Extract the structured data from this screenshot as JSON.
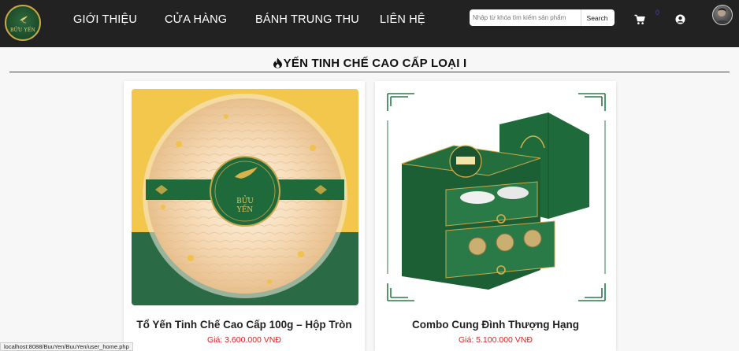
{
  "brand": {
    "logo_text": "BỬU YẾN"
  },
  "nav": {
    "items": [
      {
        "label": "GIỚI THIỆU"
      },
      {
        "label": "CỬA HÀNG"
      },
      {
        "label": "BÁNH TRUNG THU"
      },
      {
        "label": "LIÊN HỆ"
      }
    ]
  },
  "search": {
    "placeholder": "Nhập từ khóa tìm kiếm sản phẩm",
    "value": "",
    "button_label": "Search"
  },
  "cart": {
    "count": "0"
  },
  "section": {
    "title": "YẾN TINH CHẾ CAO CẤP LOẠI I"
  },
  "products": [
    {
      "name": "Tổ Yến Tinh Chế Cao Cấp 100g – Hộp Tròn",
      "price": "Giá: 3.600.000 VNĐ",
      "label_text": "BỬU YẾN"
    },
    {
      "name": "Combo Cung Đình Thượng Hạng",
      "price": "Giá: 5.100.000 VNĐ"
    }
  ],
  "status_bar": {
    "url": "localhost:8088/BuuYen/BuuYen/user_home.php"
  },
  "colors": {
    "navbar": "#222222",
    "price": "#dd2222",
    "brand_green": "#1f6a3a",
    "brand_gold": "#c9a84a"
  }
}
